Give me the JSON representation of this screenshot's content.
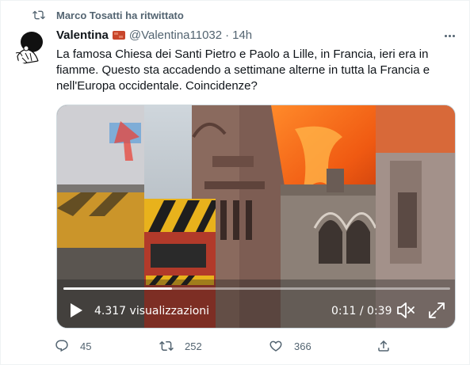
{
  "retweet": {
    "label": "Marco Tosatti ha ritwittato"
  },
  "author": {
    "name": "Valentina",
    "emoji_icon": "brick-emoji-icon",
    "handle": "@Valentina11032",
    "separator": "·",
    "time": "14h"
  },
  "tweet": {
    "text": "La famosa Chiesa dei Santi Pietro e Paolo a Lille, in Francia, ieri era in fiamme. Questo sta accadendo a settimane alterne in tutta la Francia e nell'Europa occidentale. Coincidenze?"
  },
  "video": {
    "views": "4.317 visualizzazioni",
    "timecode": "0:11 / 0:39",
    "progress_fraction": 0.28
  },
  "actions": {
    "reply_count": "45",
    "retweet_count": "252",
    "like_count": "366"
  },
  "colors": {
    "secondary_text": "#536471",
    "primary_text": "#0f1419",
    "fire": "#f2601e"
  }
}
